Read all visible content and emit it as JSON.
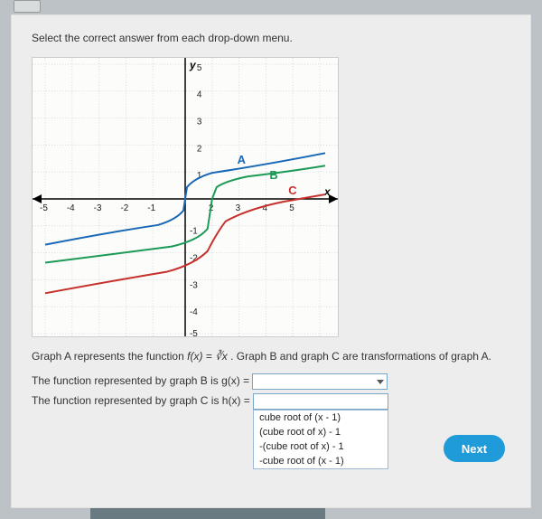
{
  "instruction": "Select the correct answer from each drop-down menu.",
  "description": {
    "prefix": "Graph A represents the function ",
    "fx": "f(x) = ∛x",
    "suffix": ". Graph B and graph C are transformations of graph A."
  },
  "row_g": {
    "label": "The function represented by graph B is  g(x) = ",
    "value": ""
  },
  "row_h": {
    "label": "The function represented by graph C is h(x) = "
  },
  "dropdown_options": [
    "cube root of (x - 1)",
    "(cube root of x) - 1",
    "-(cube root of x) - 1",
    "-cube root of (x - 1)"
  ],
  "next_label": "Next",
  "chart_data": {
    "type": "line",
    "xlim": [
      -5,
      5
    ],
    "ylim": [
      -5,
      5
    ],
    "xlabel": "x",
    "ylabel": "y",
    "grid": true,
    "series": [
      {
        "name": "A",
        "color": "#1868b5",
        "label_pos": [
          2.3,
          1.5
        ],
        "formula": "cbrt(x)"
      },
      {
        "name": "B",
        "color": "#1c9a56",
        "label_pos": [
          3.3,
          1.0
        ],
        "formula": "cbrt(x)-1 or cbrt(x-1)"
      },
      {
        "name": "C",
        "color": "#c6312d",
        "label_pos": [
          4.0,
          0.3
        ],
        "formula": "-cbrt(x)-1 or similar"
      }
    ],
    "xticks": [
      -5,
      -4,
      -3,
      -2,
      -1,
      1,
      2,
      3,
      4,
      5
    ],
    "yticks": [
      -5,
      -4,
      -3,
      -2,
      -1,
      1,
      2,
      3,
      4,
      5
    ]
  }
}
